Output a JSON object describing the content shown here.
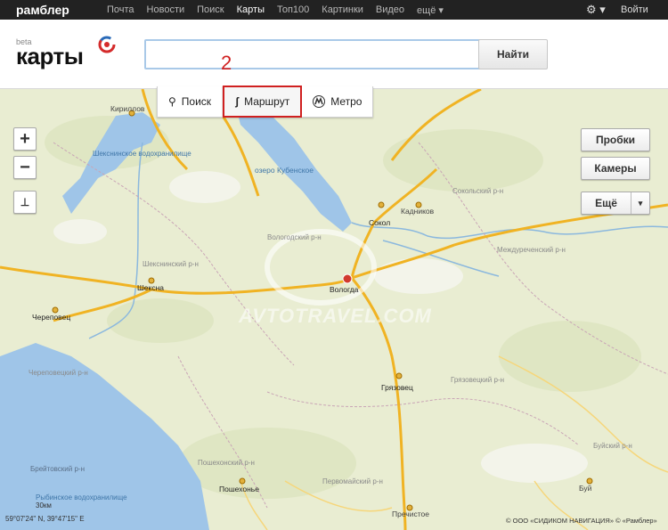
{
  "topbar": {
    "brand": "рамблер",
    "nav": [
      {
        "label": "Почта",
        "active": false
      },
      {
        "label": "Новости",
        "active": false
      },
      {
        "label": "Поиск",
        "active": false
      },
      {
        "label": "Карты",
        "active": true
      },
      {
        "label": "Топ100",
        "active": false
      },
      {
        "label": "Картинки",
        "active": false
      },
      {
        "label": "Видео",
        "active": false
      },
      {
        "label": "ещё ▾",
        "active": false
      }
    ],
    "settings_icon": "gear-icon",
    "login": "Войти"
  },
  "header": {
    "logo_beta": "beta",
    "logo_word": "карты",
    "search": {
      "value": "",
      "placeholder": ""
    },
    "search_button": "Найти"
  },
  "tabs": [
    {
      "label": "Поиск",
      "icon": "search-icon"
    },
    {
      "label": "Маршрут",
      "icon": "route-icon"
    },
    {
      "label": "Метро",
      "icon": "metro-icon"
    }
  ],
  "annotation": "2",
  "map": {
    "controls": {
      "zoom_in": "+",
      "zoom_out": "−",
      "ruler_icon": "ruler-icon"
    },
    "buttons": {
      "traffic": "Пробки",
      "cameras": "Камеры",
      "more": "Ещё",
      "more_arrow": "▾"
    },
    "places": {
      "kirillov": "Кириллов",
      "kubenskoe": "озеро Кубенское",
      "sokol": "Сокол",
      "kadnikov": "Кадников",
      "vologda": "Вологда",
      "sheksna": "Шексна",
      "cherepovets": "Череповец",
      "gryazovets": "Грязовец",
      "poshekhonye": "Пошехонье",
      "prechistoe": "Пречистое",
      "buy": "Буй"
    },
    "regions": {
      "sheksna_res": "Шекснинское водохранилище",
      "vologodsky": "Вологодский р-н",
      "sheksninsky": "Шекснинский р-н",
      "sokolsky": "Сокольский р-н",
      "mezhdurechensky": "Междуреченский р-н",
      "cherepovetsky": "Череповецкий р-н",
      "gryazovetsky": "Грязовецкий р-н",
      "poshekhonsky": "Пошехонский р-н",
      "pervomaysky": "Первомайский р-н",
      "buysky": "Буйский р-н",
      "breytovsky": "Брейтовский р-н",
      "rybinsk_res": "Рыбинское водохранилище"
    },
    "scale": "30км",
    "coordinates": "59°07'24\" N, 39°47'15\" E",
    "copyright": "© ООО «СИДИКОМ НАВИГАЦИЯ» © «Рамблер»",
    "watermark": "AVTOTRAVEL.COM"
  },
  "colors": {
    "accent": "#d02020",
    "road": "#f0b323",
    "water": "#9fc5e8",
    "land": "#e9edd2"
  }
}
